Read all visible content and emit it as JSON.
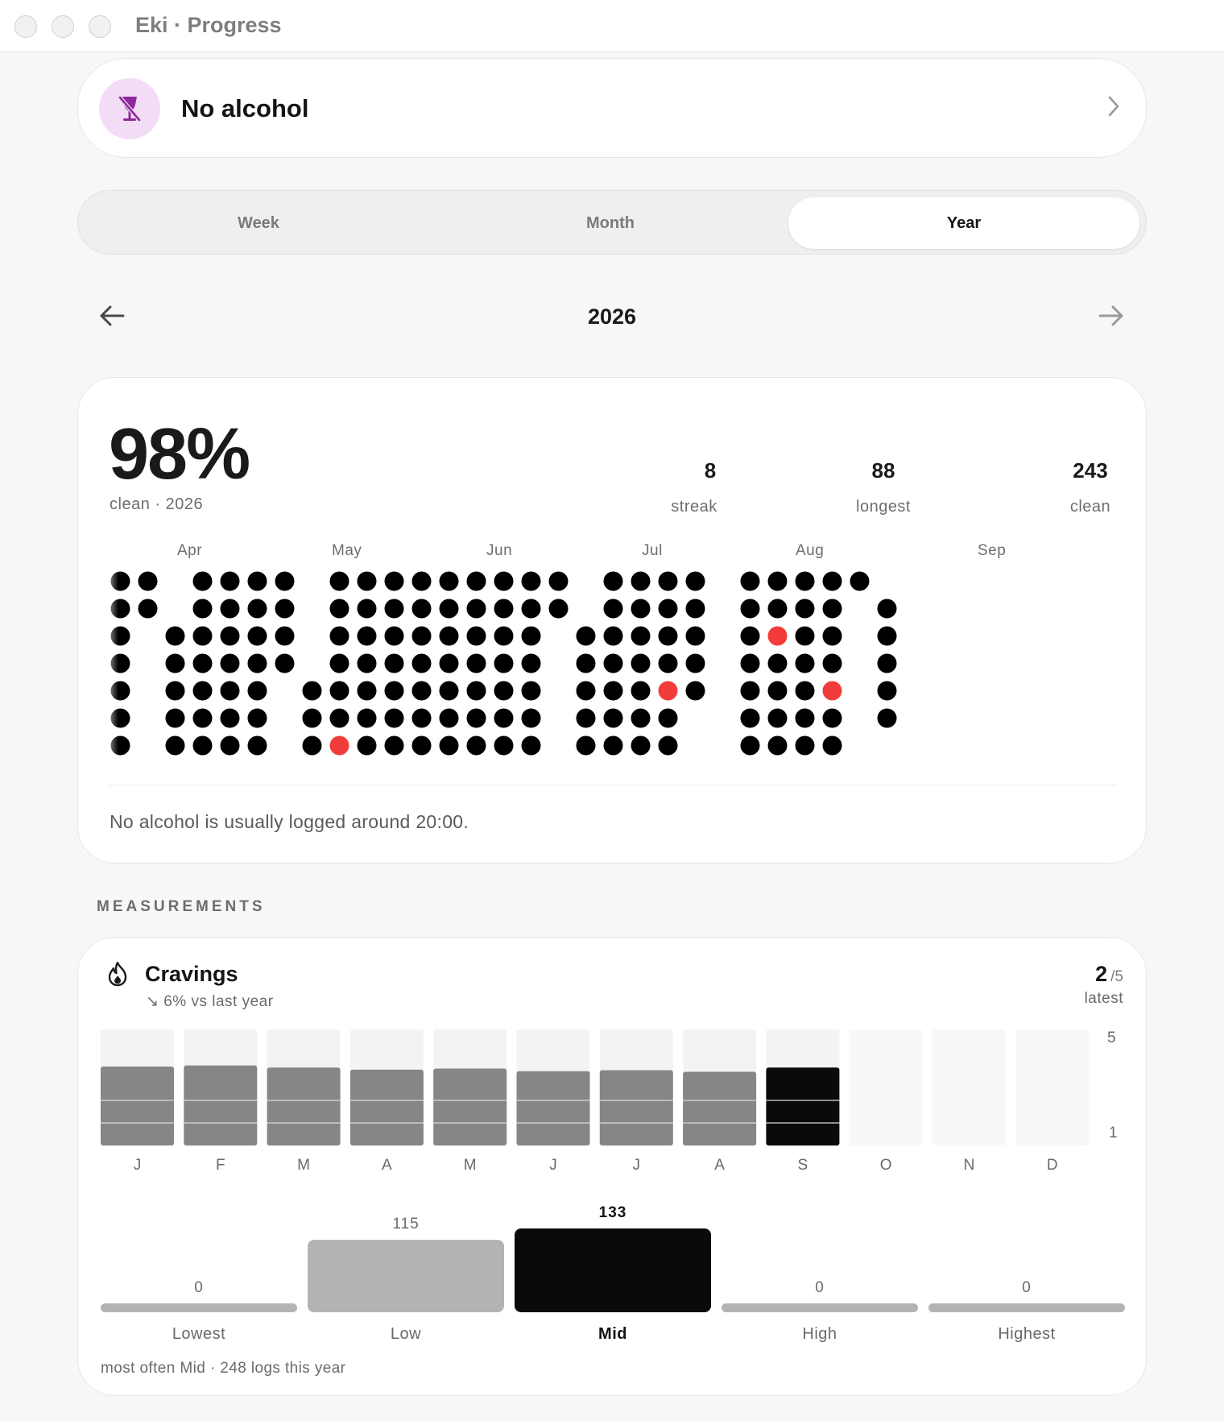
{
  "window": {
    "title": "Eki · Progress"
  },
  "habit": {
    "name": "No alcohol",
    "icon": "no-alcohol-icon"
  },
  "tabs": [
    {
      "label": "Week",
      "active": false
    },
    {
      "label": "Month",
      "active": false
    },
    {
      "label": "Year",
      "active": true
    }
  ],
  "period": {
    "label": "2026"
  },
  "stats": {
    "clean_pct": "98%",
    "clean_sub": "clean · 2026",
    "streak": {
      "value": "8",
      "label": "streak"
    },
    "longest": {
      "value": "88",
      "label": "longest"
    },
    "clean": {
      "value": "243",
      "label": "clean"
    }
  },
  "calendar": {
    "months": [
      "Apr",
      "May",
      "Jun",
      "Jul",
      "Aug",
      "Sep"
    ],
    "colors": {
      "clean": "#000000",
      "slip": "#f23c3c"
    },
    "dots": [
      [
        "c",
        "c",
        "c",
        "c",
        "c",
        "c",
        "c"
      ],
      [
        "c",
        "c",
        "",
        "",
        "",
        "",
        ""
      ],
      [
        "",
        "",
        "c",
        "c",
        "c",
        "c",
        "c"
      ],
      [
        "c",
        "c",
        "c",
        "c",
        "c",
        "c",
        "c"
      ],
      [
        "c",
        "c",
        "c",
        "c",
        "c",
        "c",
        "c"
      ],
      [
        "c",
        "c",
        "c",
        "c",
        "c",
        "c",
        "c"
      ],
      [
        "c",
        "c",
        "c",
        "c",
        "",
        "",
        ""
      ],
      [
        "",
        "",
        "",
        "",
        "c",
        "c",
        "c"
      ],
      [
        "c",
        "c",
        "c",
        "c",
        "c",
        "c",
        "s"
      ],
      [
        "c",
        "c",
        "c",
        "c",
        "c",
        "c",
        "c"
      ],
      [
        "c",
        "c",
        "c",
        "c",
        "c",
        "c",
        "c"
      ],
      [
        "c",
        "c",
        "c",
        "c",
        "c",
        "c",
        "c"
      ],
      [
        "c",
        "c",
        "c",
        "c",
        "c",
        "c",
        "c"
      ],
      [
        "c",
        "c",
        "c",
        "c",
        "c",
        "c",
        "c"
      ],
      [
        "c",
        "c",
        "c",
        "c",
        "c",
        "c",
        "c"
      ],
      [
        "c",
        "c",
        "c",
        "c",
        "c",
        "c",
        "c"
      ],
      [
        "c",
        "c",
        "",
        "",
        "",
        "",
        ""
      ],
      [
        "",
        "",
        "c",
        "c",
        "c",
        "c",
        "c"
      ],
      [
        "c",
        "c",
        "c",
        "c",
        "c",
        "c",
        "c"
      ],
      [
        "c",
        "c",
        "c",
        "c",
        "c",
        "c",
        "c"
      ],
      [
        "c",
        "c",
        "c",
        "c",
        "s",
        "c",
        "c"
      ],
      [
        "c",
        "c",
        "c",
        "c",
        "c",
        "",
        ""
      ],
      [
        "",
        "",
        "",
        "",
        "",
        "",
        ""
      ],
      [
        "c",
        "c",
        "c",
        "c",
        "c",
        "c",
        "c"
      ],
      [
        "c",
        "c",
        "s",
        "c",
        "c",
        "c",
        "c"
      ],
      [
        "c",
        "c",
        "c",
        "c",
        "c",
        "c",
        "c"
      ],
      [
        "c",
        "c",
        "c",
        "c",
        "s",
        "c",
        "c"
      ],
      [
        "c",
        "",
        "",
        "",
        "",
        "",
        ""
      ],
      [
        "",
        "c",
        "c",
        "c",
        "c",
        "c",
        ""
      ]
    ],
    "note": "No alcohol is usually logged around 20:00."
  },
  "measurements": {
    "section_label": "MEASUREMENTS",
    "name": "Cravings",
    "icon": "flame-icon",
    "trend": "↘ 6% vs last year",
    "latest_value": "2",
    "latest_scale": "/5",
    "latest_label": "latest",
    "scale_max": "5",
    "scale_min": "1",
    "months": [
      "J",
      "F",
      "M",
      "A",
      "M",
      "J",
      "J",
      "A",
      "S",
      "O",
      "N",
      "D"
    ],
    "monthly_avg": [
      2.05,
      2.07,
      2.03,
      1.99,
      2.01,
      1.96,
      1.98,
      1.95,
      2.03,
      null,
      null,
      null
    ],
    "current_month_index": 8,
    "distribution": [
      {
        "label": "Lowest",
        "count": 0
      },
      {
        "label": "Low",
        "count": 115
      },
      {
        "label": "Mid",
        "count": 133
      },
      {
        "label": "High",
        "count": 0
      },
      {
        "label": "Highest",
        "count": 0
      }
    ],
    "summary": "most often Mid · 248 logs this year"
  }
}
